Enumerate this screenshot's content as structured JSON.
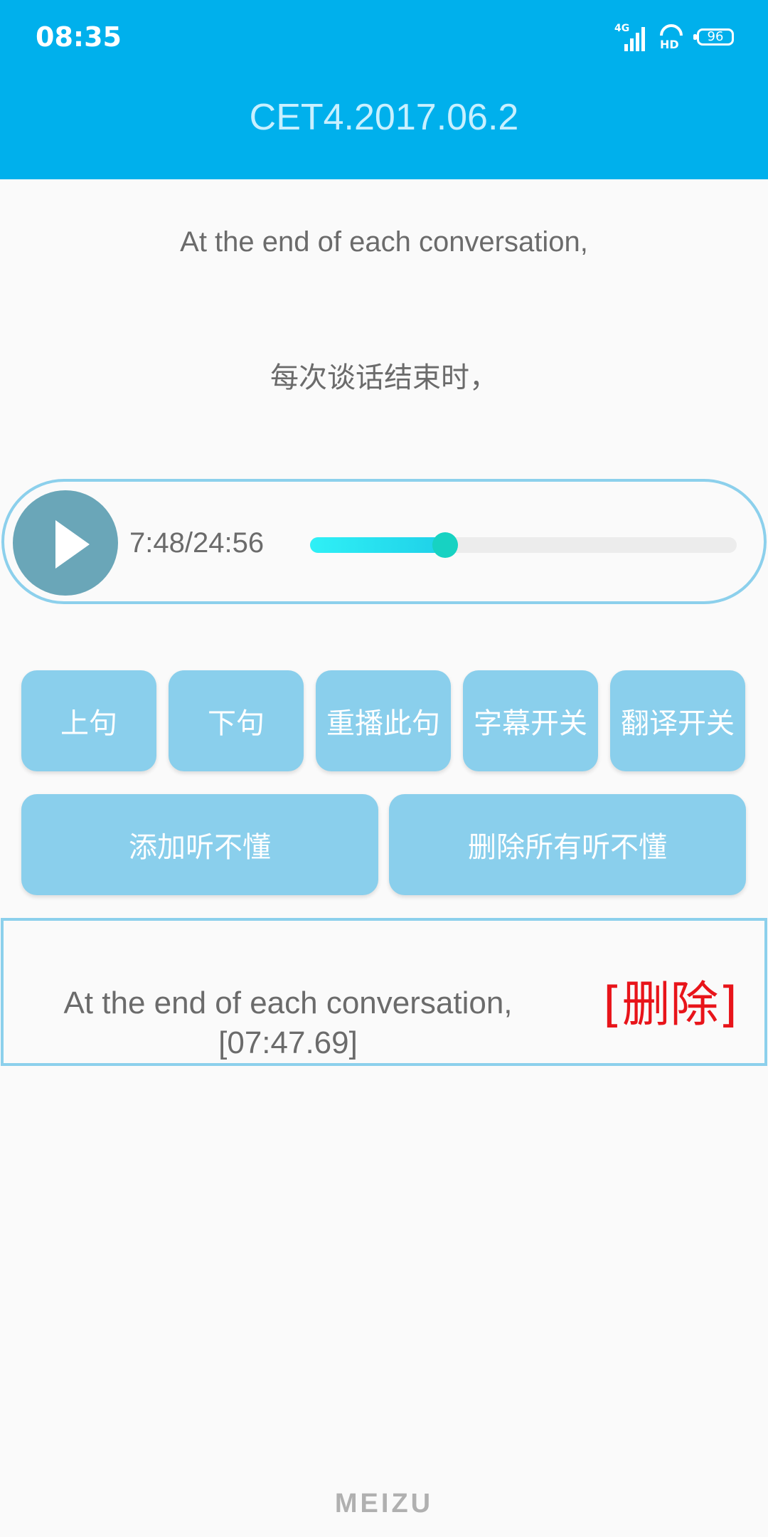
{
  "status_bar": {
    "time": "08:35",
    "network": "4G",
    "hd": "HD",
    "battery": "96",
    "icons": [
      "signal-icon",
      "hd-voice-icon",
      "battery-icon"
    ]
  },
  "header": {
    "title": "CET4.2017.06.2",
    "background": "#00b0ec"
  },
  "subtitle": {
    "english": "At the end of each conversation,",
    "chinese": "每次谈话结束时，"
  },
  "player": {
    "play_icon": "play-icon",
    "time_display": "7:48/24:56",
    "progress": 0.316
  },
  "controls": {
    "prev_label": "上句",
    "next_label": "下句",
    "replay_label": "重播此句",
    "subtitle_toggle_label": "字幕开关",
    "translation_toggle_label": "翻译开关",
    "add_label": "添加听不懂",
    "delete_all_label": "删除所有听不懂"
  },
  "saved_items": [
    {
      "text": "At the end of each conversation,",
      "timestamp": "[07:47.69]",
      "delete_label": "[删除]"
    }
  ],
  "brand": "MEIZU",
  "colors": {
    "button": "#8acfec",
    "border": "#8cd0ec",
    "delete": "#e8141a",
    "play_button": "#6aa6b8"
  }
}
